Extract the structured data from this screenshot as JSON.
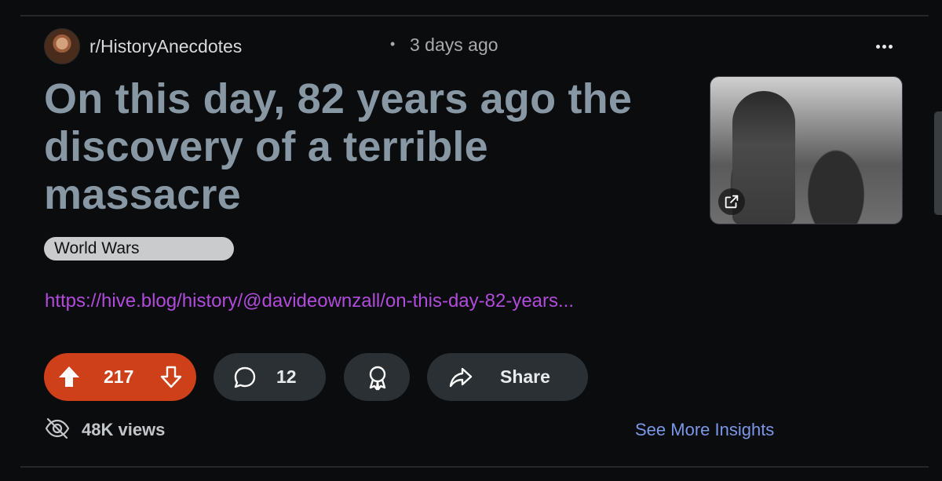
{
  "post": {
    "subreddit": "r/HistoryAnecdotes",
    "separator": "•",
    "time": "3 days ago",
    "title": "On this day, 82 years ago the discovery of a terrible massacre",
    "tag": "World Wars",
    "link_text": "https://hive.blog/history/@davideownzall/on-this-day-82-years...",
    "thumbnail_icon": "external-link-icon"
  },
  "actions": {
    "votes": "217",
    "comments": "12",
    "share_label": "Share"
  },
  "footer": {
    "views": "48K views",
    "insights_label": "See More Insights"
  },
  "colors": {
    "upvote_bg": "#cd4019",
    "link": "#b04bdb",
    "insights": "#7b97e8",
    "title": "#8797a3"
  }
}
